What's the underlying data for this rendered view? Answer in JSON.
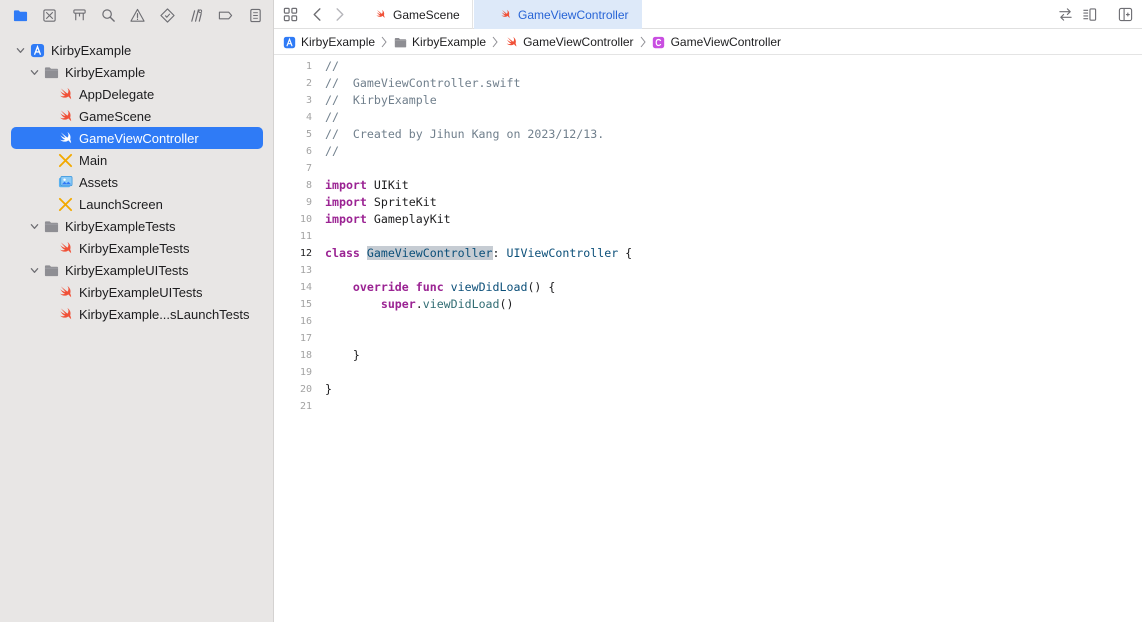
{
  "navigator": {
    "toolbar_icons": [
      "folder-icon",
      "source-control-icon",
      "hierarchy-icon",
      "search-icon",
      "warning-icon",
      "test-icon",
      "debug-icon",
      "breakpoint-icon",
      "report-icon"
    ],
    "tree": [
      {
        "label": "KirbyExample",
        "icon": "app-project-icon",
        "level": 0,
        "expanded": true
      },
      {
        "label": "KirbyExample",
        "icon": "folder-icon",
        "level": 1,
        "expanded": true
      },
      {
        "label": "AppDelegate",
        "icon": "swift-file-icon",
        "level": 2
      },
      {
        "label": "GameScene",
        "icon": "swift-file-icon",
        "level": 2
      },
      {
        "label": "GameViewController",
        "icon": "swift-file-icon",
        "level": 2,
        "selected": true
      },
      {
        "label": "Main",
        "icon": "storyboard-icon",
        "level": 2
      },
      {
        "label": "Assets",
        "icon": "asset-catalog-icon",
        "level": 2
      },
      {
        "label": "LaunchScreen",
        "icon": "storyboard-icon",
        "level": 2
      },
      {
        "label": "KirbyExampleTests",
        "icon": "folder-icon",
        "level": 1,
        "expanded": true
      },
      {
        "label": "KirbyExampleTests",
        "icon": "swift-file-icon",
        "level": 2
      },
      {
        "label": "KirbyExampleUITests",
        "icon": "folder-icon",
        "level": 1,
        "expanded": true
      },
      {
        "label": "KirbyExampleUITests",
        "icon": "swift-file-icon",
        "level": 2
      },
      {
        "label": "KirbyExample...sLaunchTests",
        "icon": "swift-file-icon",
        "level": 2
      }
    ]
  },
  "editor": {
    "tabs": [
      {
        "label": "GameScene",
        "active": false
      },
      {
        "label": "GameViewController",
        "active": true
      }
    ],
    "breadcrumb": [
      {
        "label": "KirbyExample",
        "icon": "app-project-icon"
      },
      {
        "label": "KirbyExample",
        "icon": "folder-icon"
      },
      {
        "label": "GameViewController",
        "icon": "swift-file-icon"
      },
      {
        "label": "GameViewController",
        "icon": "class-icon"
      }
    ],
    "current_line": 12,
    "code_lines": [
      {
        "n": "1",
        "tokens": [
          {
            "t": "//",
            "k": "comment"
          }
        ]
      },
      {
        "n": "2",
        "tokens": [
          {
            "t": "//  GameViewController.swift",
            "k": "comment"
          }
        ]
      },
      {
        "n": "3",
        "tokens": [
          {
            "t": "//  KirbyExample",
            "k": "comment"
          }
        ]
      },
      {
        "n": "4",
        "tokens": [
          {
            "t": "//",
            "k": "comment"
          }
        ]
      },
      {
        "n": "5",
        "tokens": [
          {
            "t": "//  Created by Jihun Kang on 2023/12/13.",
            "k": "comment"
          }
        ]
      },
      {
        "n": "6",
        "tokens": [
          {
            "t": "//",
            "k": "comment"
          }
        ]
      },
      {
        "n": "7",
        "tokens": []
      },
      {
        "n": "8",
        "tokens": [
          {
            "t": "import",
            "k": "keyword"
          },
          {
            "t": " UIKit",
            "k": "plain"
          }
        ]
      },
      {
        "n": "9",
        "tokens": [
          {
            "t": "import",
            "k": "keyword"
          },
          {
            "t": " SpriteKit",
            "k": "plain"
          }
        ]
      },
      {
        "n": "10",
        "tokens": [
          {
            "t": "import",
            "k": "keyword"
          },
          {
            "t": " GameplayKit",
            "k": "plain"
          }
        ]
      },
      {
        "n": "11",
        "tokens": []
      },
      {
        "n": "12",
        "tokens": [
          {
            "t": "class",
            "k": "keyword"
          },
          {
            "t": " ",
            "k": "plain"
          },
          {
            "t": "GameViewController",
            "k": "highlight"
          },
          {
            "t": ": ",
            "k": "plain"
          },
          {
            "t": "UIViewController",
            "k": "type2"
          },
          {
            "t": " {",
            "k": "plain"
          }
        ]
      },
      {
        "n": "13",
        "tokens": []
      },
      {
        "n": "14",
        "tokens": [
          {
            "t": "    ",
            "k": "plain"
          },
          {
            "t": "override",
            "k": "keyword"
          },
          {
            "t": " ",
            "k": "plain"
          },
          {
            "t": "func",
            "k": "keyword"
          },
          {
            "t": " ",
            "k": "plain"
          },
          {
            "t": "viewDidLoad",
            "k": "type2"
          },
          {
            "t": "() {",
            "k": "plain"
          }
        ]
      },
      {
        "n": "15",
        "tokens": [
          {
            "t": "        ",
            "k": "plain"
          },
          {
            "t": "super",
            "k": "keyword"
          },
          {
            "t": ".",
            "k": "plain"
          },
          {
            "t": "viewDidLoad",
            "k": "call"
          },
          {
            "t": "()",
            "k": "plain"
          }
        ]
      },
      {
        "n": "16",
        "tokens": []
      },
      {
        "n": "17",
        "tokens": []
      },
      {
        "n": "18",
        "tokens": [
          {
            "t": "    }",
            "k": "plain"
          }
        ]
      },
      {
        "n": "19",
        "tokens": []
      },
      {
        "n": "20",
        "tokens": [
          {
            "t": "}",
            "k": "plain"
          }
        ]
      },
      {
        "n": "21",
        "tokens": []
      }
    ]
  },
  "colors": {
    "accent": "#2f7bf6",
    "swift": "#f05138",
    "storyboard": "#f2a900",
    "folder": "#8e8e93",
    "class_badge": "#c94fe1"
  }
}
